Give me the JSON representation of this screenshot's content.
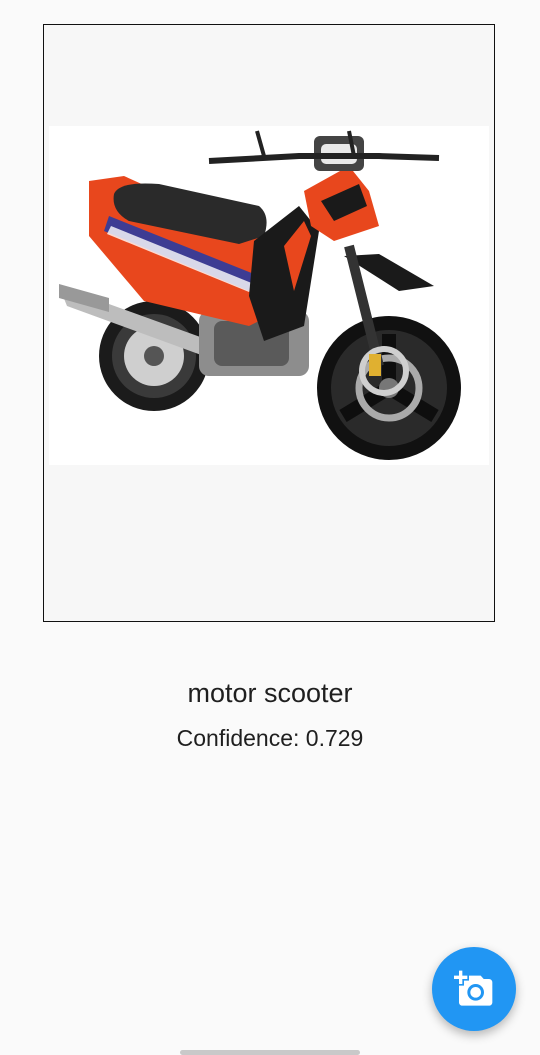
{
  "image": {
    "subject": "motorcycle-photo",
    "colors": {
      "body": "#e8471d",
      "seat": "#2a2a2a",
      "frame_black": "#1a1a1a",
      "chrome": "#b9b9b9"
    }
  },
  "result": {
    "label": "motor scooter",
    "confidence_text": "Confidence: 0.729"
  },
  "fab": {
    "icon": "add-a-photo-icon",
    "color": "#2196f3"
  }
}
